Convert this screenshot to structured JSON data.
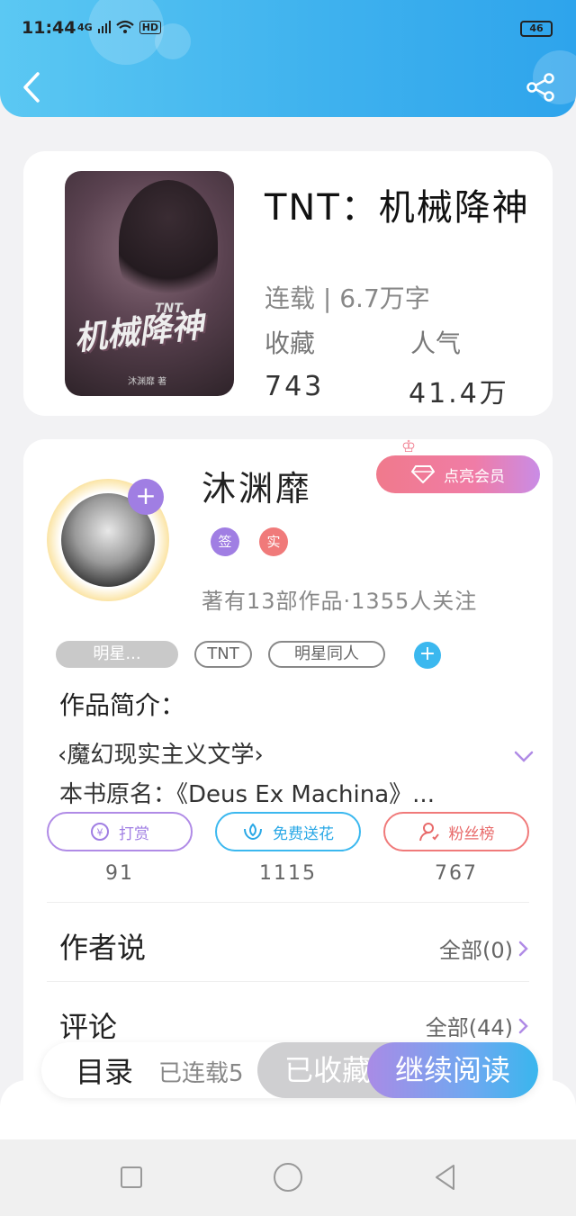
{
  "status_bar": {
    "time": "11:44",
    "network": "4G",
    "hd": "HD",
    "battery": "46"
  },
  "header": {
    "back_icon": "chevron-left-icon",
    "share_icon": "share-icon",
    "accent": "#3fb2ee"
  },
  "book": {
    "cover_title": "机械降神",
    "cover_subtitle": "TNT",
    "cover_author": "沐渊靡 著",
    "title": "TNT：机械降神",
    "status": "连载 | 6.7万字",
    "stats": [
      {
        "label": "收藏",
        "value": "743"
      },
      {
        "label": "人气",
        "value": "41.4万"
      }
    ]
  },
  "author": {
    "name": "沐渊靡",
    "vip_button": "点亮会员",
    "badges": [
      {
        "text": "签",
        "color": "#a07ee3"
      },
      {
        "text": "实",
        "color": "#f07a7a"
      }
    ],
    "meta": "著有13部作品·1355人关注"
  },
  "tags": [
    "明星...",
    "TNT",
    "明星同人"
  ],
  "intro": {
    "heading": "作品简介：",
    "line1": "‹魔幻现实主义文学›",
    "line2": "本书原名：《Deus Ex Machina》..."
  },
  "actions": [
    {
      "label": "打赏",
      "count": "91",
      "color": "#b08be6"
    },
    {
      "label": "免费送花",
      "count": "1115",
      "color": "#3bb8ef"
    },
    {
      "label": "粉丝榜",
      "count": "767",
      "color": "#f07a7a"
    }
  ],
  "author_says": {
    "title": "作者说",
    "link": "全部(0)"
  },
  "comments": {
    "title": "评论",
    "link": "全部(44)"
  },
  "bottom_bar": {
    "toc": "目录",
    "serial": "已连载5",
    "collected": "已收藏",
    "continue": "继续阅读"
  }
}
